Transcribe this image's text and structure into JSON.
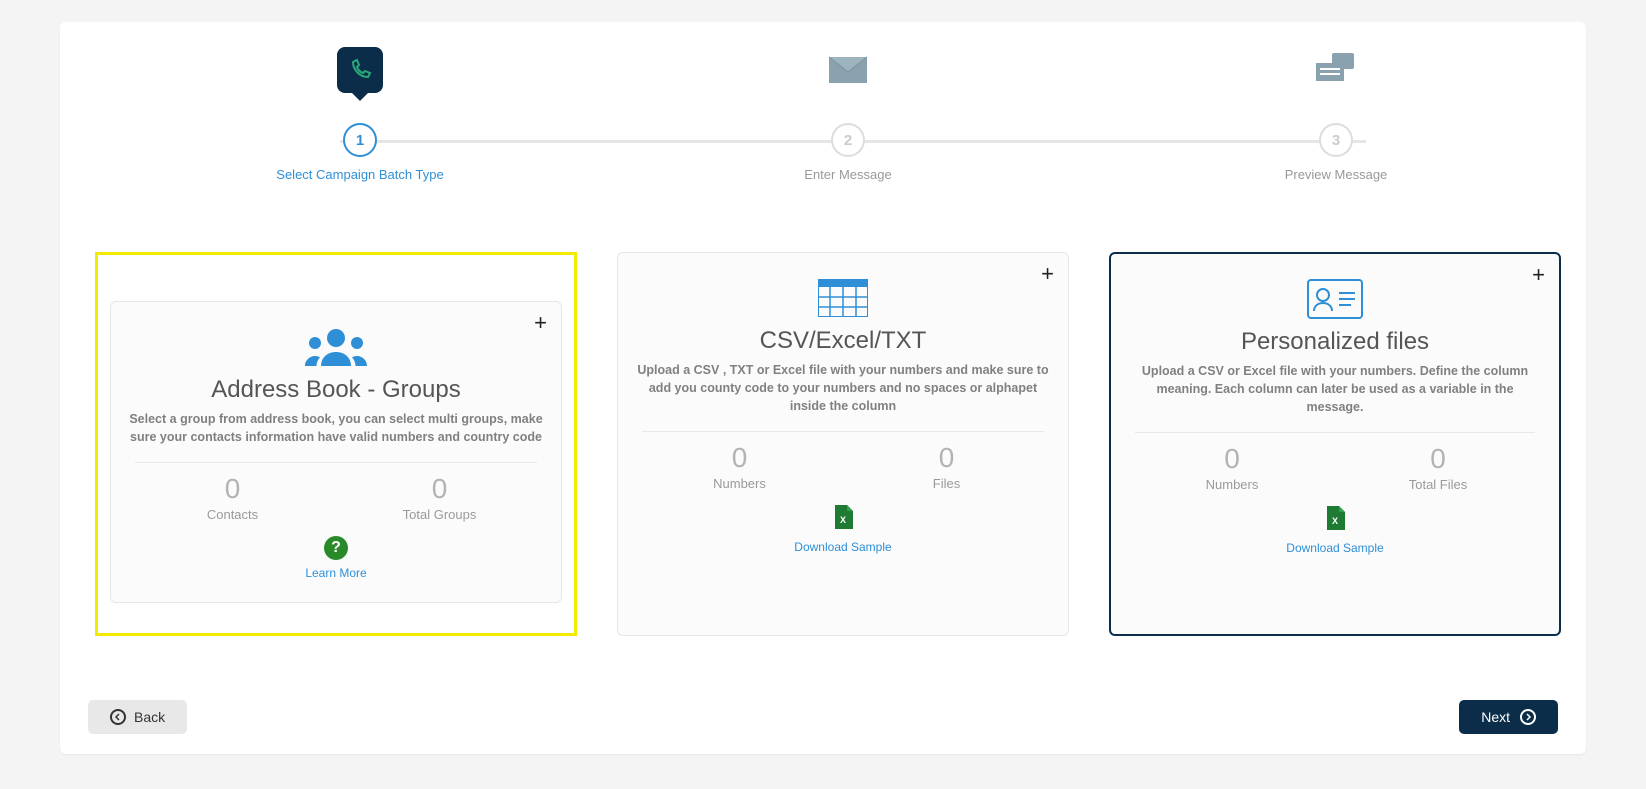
{
  "stepper": {
    "steps": [
      {
        "num": "1",
        "label": "Select Campaign Batch Type"
      },
      {
        "num": "2",
        "label": "Enter Message"
      },
      {
        "num": "3",
        "label": "Preview Message"
      }
    ]
  },
  "cards": {
    "address_book": {
      "title": "Address Book - Groups",
      "desc": "Select a group from address book, you can select multi groups, make sure your contacts information have valid numbers and country code",
      "stat1_value": "0",
      "stat1_label": "Contacts",
      "stat2_value": "0",
      "stat2_label": "Total Groups",
      "link": "Learn More"
    },
    "csv": {
      "title": "CSV/Excel/TXT",
      "desc": "Upload a CSV , TXT or Excel file with your numbers and make sure to add you county code to your numbers and no spaces or alphapet inside the column",
      "stat1_value": "0",
      "stat1_label": "Numbers",
      "stat2_value": "0",
      "stat2_label": "Files",
      "link": "Download Sample"
    },
    "personalized": {
      "title": "Personalized files",
      "desc": "Upload a CSV or Excel file with your numbers. Define the column meaning. Each column can later be used as a variable in the message.",
      "stat1_value": "0",
      "stat1_label": "Numbers",
      "stat2_value": "0",
      "stat2_label": "Total Files",
      "link": "Download Sample"
    }
  },
  "footer": {
    "back": "Back",
    "next": "Next"
  }
}
